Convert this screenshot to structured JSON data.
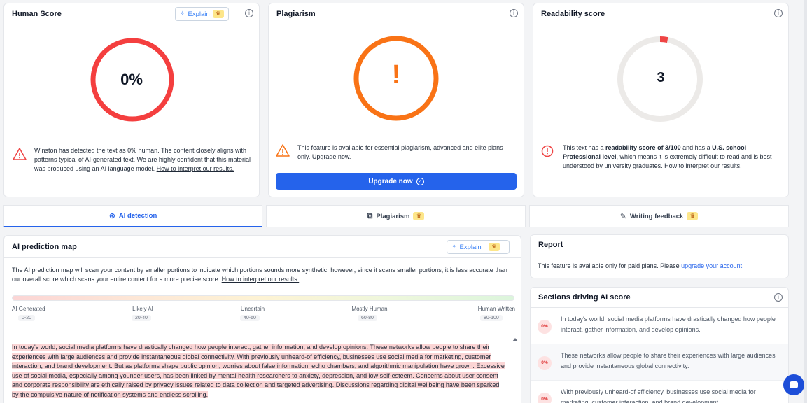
{
  "human_score": {
    "title": "Human Score",
    "explain_label": "Explain",
    "value": "0%",
    "message": "Winston has detected the text as 0% human. The content closely aligns with patterns typical of AI-generated text. We are highly confident that this material was produced using an AI language model.",
    "link": "How to interpret our results.",
    "ring_color": "#f43f3f"
  },
  "plagiarism": {
    "title": "Plagiarism",
    "symbol": "!",
    "message": "This feature is available for essential plagiarism, advanced and elite plans only. Upgrade now.",
    "upgrade_label": "Upgrade now",
    "ring_color": "#f97316"
  },
  "readability": {
    "title": "Readability score",
    "value": "3",
    "fraction": 0.03,
    "msg_pre": "This text has a ",
    "msg_bold1": "readability score of 3/100",
    "msg_mid": " and has a ",
    "msg_bold2": "U.S. school Professional level",
    "msg_post": ", which means it is extremely difficult to read and is best understood by university graduates. ",
    "link": "How to interpret our results."
  },
  "tabs": [
    {
      "label": "AI detection",
      "icon": "ai-detection-icon"
    },
    {
      "label": "Plagiarism",
      "icon": "plagiarism-icon"
    },
    {
      "label": "Writing feedback",
      "icon": "writing-feedback-icon"
    }
  ],
  "prediction_map": {
    "title": "AI prediction map",
    "explain_label": "Explain",
    "description": "The AI prediction map will scan your content by smaller portions to indicate which portions sounds more synthetic, however, since it scans smaller portions, it is less accurate than our overall score which scans your entire content for a more precise score.",
    "link": "How to interpret our results.",
    "scale": [
      {
        "label": "AI Generated",
        "range": "0-20"
      },
      {
        "label": "Likely AI",
        "range": "20-40"
      },
      {
        "label": "Uncertain",
        "range": "40-60"
      },
      {
        "label": "Mostly Human",
        "range": "60-80"
      },
      {
        "label": "Human Written",
        "range": "80-100"
      }
    ],
    "text": "In today's world, social media platforms have drastically changed how people interact, gather information, and develop opinions. These networks allow people to share their experiences with large audiences and provide instantaneous global connectivity. With previously unheard-of efficiency, businesses use social media for marketing, customer interaction, and brand development. But as platforms shape public opinion, worries about false information, echo chambers, and algorithmic manipulation have grown. Excessive use of social media, especially among younger users, has been linked by mental health researchers to anxiety, depression, and low self-esteem. Concerns about user consent and corporate responsibility are ethically raised by privacy issues related to data collection and targeted advertising. Discussions regarding digital wellbeing have been sparked by the compulsive nature of notification systems and endless scrolling."
  },
  "report": {
    "title": "Report",
    "text_pre": "This feature is available only for paid plans. Please ",
    "link": "upgrade your account",
    "text_post": "."
  },
  "sections": {
    "title": "Sections driving AI score",
    "items": [
      {
        "pct": "0%",
        "text": "In today's world, social media platforms have drastically changed how people interact, gather information, and develop opinions."
      },
      {
        "pct": "0%",
        "text": "These networks allow people to share their experiences with large audiences and provide instantaneous global connectivity."
      },
      {
        "pct": "0%",
        "text": "With previously unheard-of efficiency, businesses use social media for marketing, customer interaction, and brand development."
      }
    ]
  },
  "colors": {
    "accent": "#2563eb",
    "danger": "#f43f3f",
    "orange": "#f97316"
  }
}
